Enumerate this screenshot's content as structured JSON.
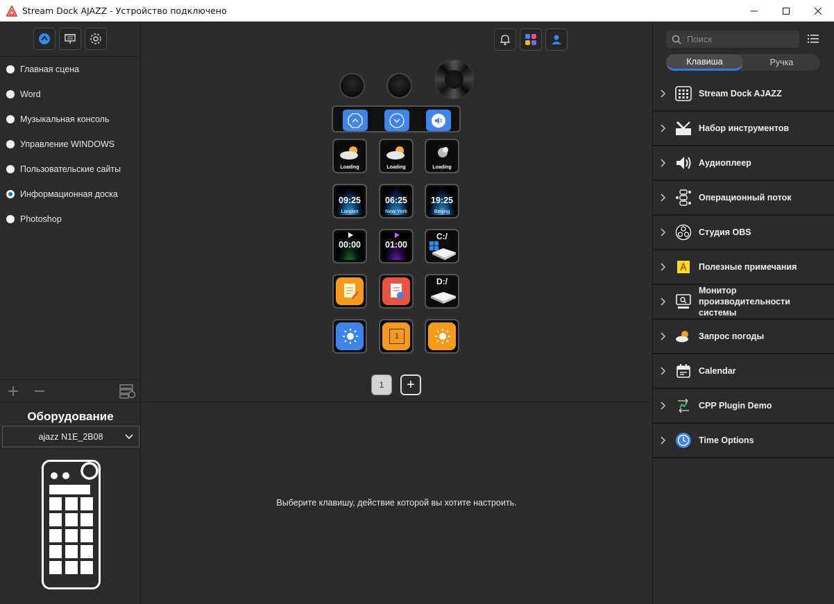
{
  "window": {
    "title": "Stream Dock AJAZZ - Устройство подключено"
  },
  "scenes": [
    {
      "label": "Главная сцена",
      "selected": false
    },
    {
      "label": "Word",
      "selected": false
    },
    {
      "label": "Музыкальная консоль",
      "selected": false
    },
    {
      "label": "Управление WINDOWS",
      "selected": false
    },
    {
      "label": "Пользовательские сайты",
      "selected": false
    },
    {
      "label": "Информационная доска",
      "selected": true
    },
    {
      "label": "Photoshop",
      "selected": false
    }
  ],
  "hardware": {
    "title": "Оборудование",
    "device": "ajazz N1E_2B08"
  },
  "keys": {
    "weather": [
      "Loading",
      "Loading",
      "Loading"
    ],
    "clocks": [
      {
        "time": "09:25",
        "city": "London"
      },
      {
        "time": "06:25",
        "city": "New York"
      },
      {
        "time": "19:25",
        "city": "Beijing"
      }
    ],
    "timers": [
      "00:00",
      "01:00"
    ],
    "drives": [
      "C:/",
      "D:/"
    ],
    "counter": "1"
  },
  "pages": {
    "current": "1",
    "add_label": "+"
  },
  "hint": "Выберите клавишу, действие которой вы хотите настроить.",
  "search": {
    "placeholder": "Поиск"
  },
  "tabs": [
    "Клавиша",
    "Ручка"
  ],
  "categories": [
    {
      "label": "Stream Dock AJAZZ",
      "icon": "keypad-icon"
    },
    {
      "label": "Набор инструментов",
      "icon": "toolkit-icon"
    },
    {
      "label": "Аудиоплеер",
      "icon": "speaker-icon"
    },
    {
      "label": "Операционный поток",
      "icon": "flow-icon"
    },
    {
      "label": "Студия OBS",
      "icon": "obs-icon"
    },
    {
      "label": "Полезные примечания",
      "icon": "note-icon"
    },
    {
      "label": "Монитор производительности системы",
      "icon": "monitor-icon"
    },
    {
      "label": "Запрос погоды",
      "icon": "weather-icon"
    },
    {
      "label": "Calendar",
      "icon": "calendar-icon"
    },
    {
      "label": "CPP Plugin Demo",
      "icon": "cpp-icon"
    },
    {
      "label": "Time Options",
      "icon": "clock-icon"
    }
  ],
  "colors": {
    "accent": "#2f7fe0",
    "key_blue": "#3e84ea",
    "key_orange": "#f59a1b",
    "key_red": "#e9533f"
  }
}
